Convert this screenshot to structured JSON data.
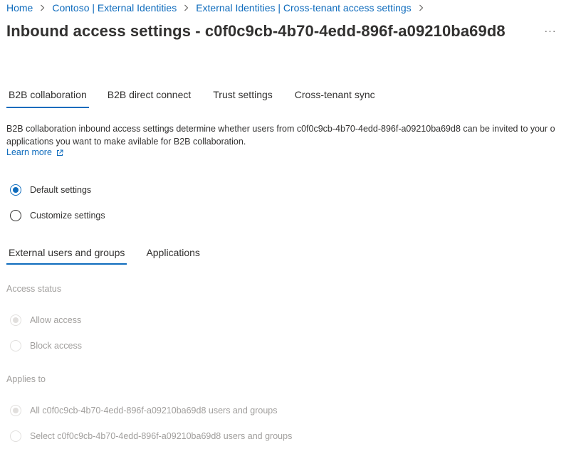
{
  "breadcrumb": {
    "items": [
      "Home",
      "Contoso | External Identities",
      "External Identities | Cross-tenant access settings"
    ],
    "separator": ">"
  },
  "page": {
    "title": "Inbound access settings - c0f0c9cb-4b70-4edd-896f-a09210ba69d8",
    "more_label": "···"
  },
  "tabs": [
    {
      "label": "B2B collaboration",
      "active": true
    },
    {
      "label": "B2B direct connect",
      "active": false
    },
    {
      "label": "Trust settings",
      "active": false
    },
    {
      "label": "Cross-tenant sync",
      "active": false
    }
  ],
  "description": {
    "line1": "B2B collaboration inbound access settings determine whether users from c0f0c9cb-4b70-4edd-896f-a09210ba69d8 can be invited to your o",
    "line2": "applications you want to make avilable for B2B collaboration.",
    "learn_more": "Learn more",
    "learn_more_icon": "external-link-icon"
  },
  "settings_mode": {
    "options": [
      {
        "label": "Default settings",
        "checked": true
      },
      {
        "label": "Customize settings",
        "checked": false
      }
    ]
  },
  "subtabs": [
    {
      "label": "External users and groups",
      "active": true
    },
    {
      "label": "Applications",
      "active": false
    }
  ],
  "access_status": {
    "label": "Access status",
    "options": [
      {
        "label": "Allow access",
        "checked": true,
        "disabled": true
      },
      {
        "label": "Block access",
        "checked": false,
        "disabled": true
      }
    ]
  },
  "applies_to": {
    "label": "Applies to",
    "options": [
      {
        "label": "All c0f0c9cb-4b70-4edd-896f-a09210ba69d8 users and groups",
        "checked": true,
        "disabled": true
      },
      {
        "label": "Select c0f0c9cb-4b70-4edd-896f-a09210ba69d8 users and groups",
        "checked": false,
        "disabled": true
      }
    ]
  },
  "colors": {
    "accent": "#0f6cbd",
    "text": "#323130",
    "disabled_text": "#a19f9d",
    "disabled_border": "#e1dfdd"
  }
}
